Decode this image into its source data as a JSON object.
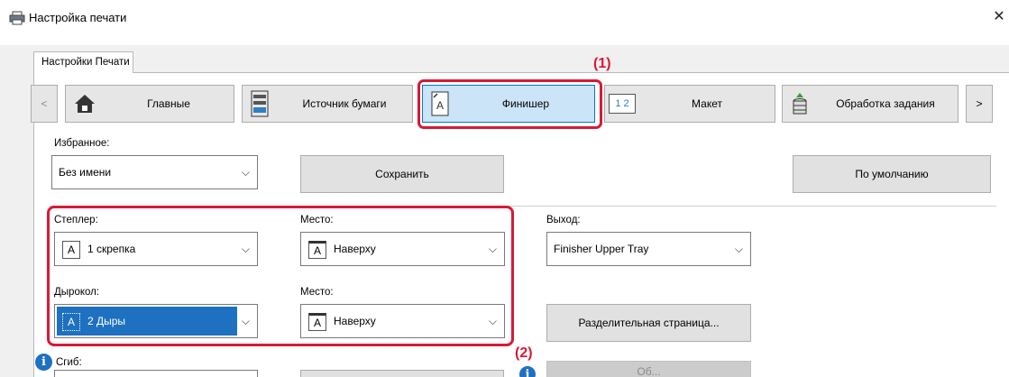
{
  "window": {
    "title": "Настройка печати",
    "close_glyph": "✕"
  },
  "tab": {
    "label": "Настройки Печати"
  },
  "toolbar": {
    "prev_glyph": "<",
    "next_glyph": ">",
    "buttons": [
      {
        "label": "Главные",
        "icon": "home-icon"
      },
      {
        "label": "Источник бумаги",
        "icon": "paper-tray-icon"
      },
      {
        "label": "Финишер",
        "icon": "finisher-icon",
        "selected": true
      },
      {
        "label": "Макет",
        "icon": "layout-icon"
      },
      {
        "label": "Обработка задания",
        "icon": "job-stack-icon"
      }
    ],
    "layout_icon_text": "1 2"
  },
  "favorites": {
    "label": "Избранное:",
    "value": "Без имени",
    "save_label": "Сохранить",
    "default_label": "По умолчанию"
  },
  "finishing": {
    "stapler_label": "Степлер:",
    "stapler_value": "1 скрепка",
    "stapler_place_label": "Место:",
    "stapler_place_value": "Наверху",
    "punch_label": "Дырокол:",
    "punch_value": "2 Дыры",
    "punch_place_label": "Место:",
    "punch_place_value": "Наверху",
    "output_label": "Выход:",
    "output_value": "Finisher Upper Tray",
    "separator_page_label": "Разделительная страница...",
    "fold_label": "Сгиб:",
    "disabled_button_label": "Об..."
  },
  "callouts": {
    "one": "(1)",
    "two": "(2)"
  },
  "colors": {
    "accent": "#0078d7",
    "highlight": "#d71a36",
    "selection": "#1e70c1"
  }
}
